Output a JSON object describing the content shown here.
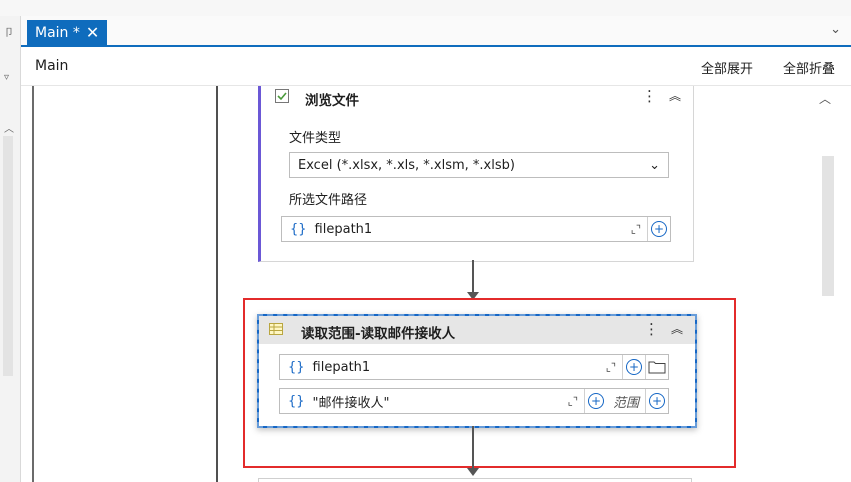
{
  "tab": {
    "label": "Main *",
    "close_glyph": "✕",
    "dropdown_glyph": "⌄"
  },
  "breadcrumb": {
    "label": "Main"
  },
  "actions": {
    "expand_all": "全部展开",
    "collapse_all": "全部折叠"
  },
  "left_panel": {
    "glyph_top": "卩",
    "glyph_filter": "▿",
    "glyph_up": "︿"
  },
  "canvas": {
    "scroll_up_glyph": "︿"
  },
  "browse_card": {
    "title": "浏览文件",
    "icon": "checkbox-icon",
    "menu_glyph": "⋮",
    "collapse_glyph": "︽",
    "file_type_label": "文件类型",
    "file_type_value": "Excel (*.xlsx, *.xls, *.xlsm, *.xlsb)",
    "path_label": "所选文件路径",
    "path_value": "filepath1"
  },
  "read_card": {
    "title": "读取范围-读取邮件接收人",
    "icon": "excel-range-icon",
    "menu_glyph": "⋮",
    "collapse_glyph": "︽",
    "file_value": "filepath1",
    "sheet_value": "\"邮件接收人\"",
    "range_placeholder": "范围"
  },
  "common": {
    "brace": "{}",
    "expand_glyph": "⌞⌝",
    "plus_glyph": "+"
  },
  "colors": {
    "accent": "#0f6cbd",
    "highlight_box": "#e32b2b",
    "selected_border": "#1667c5",
    "browse_bar": "#6b58d6"
  }
}
